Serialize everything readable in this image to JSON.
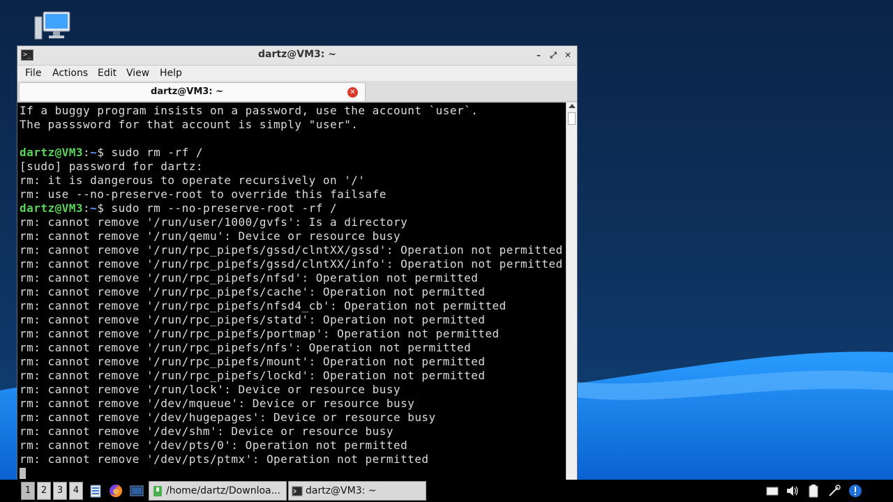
{
  "window": {
    "title": "dartz@VM3: ~",
    "controls": {
      "minimize": "–",
      "maximize": "⤢",
      "close": "✕"
    }
  },
  "menubar": {
    "items": [
      "File",
      "Actions",
      "Edit",
      "View",
      "Help"
    ]
  },
  "tab": {
    "label": "dartz@VM3: ~",
    "close": "✕"
  },
  "terminal": {
    "lines": [
      "If a buggy program insists on a password, use the account `user`.",
      "The passsword for that account is simply \"user\".",
      "",
      {
        "user": "dartz@VM3",
        "sep": ":",
        "path": "~",
        "prompt": "$ ",
        "cmd": "sudo rm -rf /"
      },
      "[sudo] password for dartz:",
      "rm: it is dangerous to operate recursively on '/'",
      "rm: use --no-preserve-root to override this failsafe",
      {
        "user": "dartz@VM3",
        "sep": ":",
        "path": "~",
        "prompt": "$ ",
        "cmd": "sudo rm --no-preserve-root -rf /"
      },
      "rm: cannot remove '/run/user/1000/gvfs': Is a directory",
      "rm: cannot remove '/run/qemu': Device or resource busy",
      "rm: cannot remove '/run/rpc_pipefs/gssd/clntXX/gssd': Operation not permitted",
      "rm: cannot remove '/run/rpc_pipefs/gssd/clntXX/info': Operation not permitted",
      "rm: cannot remove '/run/rpc_pipefs/nfsd': Operation not permitted",
      "rm: cannot remove '/run/rpc_pipefs/cache': Operation not permitted",
      "rm: cannot remove '/run/rpc_pipefs/nfsd4_cb': Operation not permitted",
      "rm: cannot remove '/run/rpc_pipefs/statd': Operation not permitted",
      "rm: cannot remove '/run/rpc_pipefs/portmap': Operation not permitted",
      "rm: cannot remove '/run/rpc_pipefs/nfs': Operation not permitted",
      "rm: cannot remove '/run/rpc_pipefs/mount': Operation not permitted",
      "rm: cannot remove '/run/rpc_pipefs/lockd': Operation not permitted",
      "rm: cannot remove '/run/lock': Device or resource busy",
      "rm: cannot remove '/dev/mqueue': Device or resource busy",
      "rm: cannot remove '/dev/hugepages': Device or resource busy",
      "rm: cannot remove '/dev/shm': Device or resource busy",
      "rm: cannot remove '/dev/pts/0': Operation not permitted",
      "rm: cannot remove '/dev/pts/ptmx': Operation not permitted"
    ]
  },
  "taskbar": {
    "workspaces": [
      "1",
      "2",
      "3",
      "4"
    ],
    "active_workspace": "1",
    "quicklaunch_icons": [
      "file-manager-icon",
      "firefox-icon",
      "terminal-launcher-icon"
    ],
    "tasks": [
      {
        "label": "/home/dartz/Downloa...",
        "icon": "folder-icon"
      },
      {
        "label": "dartz@VM3: ~",
        "icon": "terminal-icon"
      }
    ],
    "tray_icons": [
      "clipboard-icon",
      "volume-icon",
      "battery-icon",
      "network-icon",
      "update-icon"
    ]
  },
  "colors": {
    "desktop": "#0a2447",
    "accent_wave": "#1a8fff",
    "terminal_bg": "#000000",
    "terminal_fg": "#dcdcdc",
    "prompt_user": "#5ad35a",
    "prompt_path": "#6b9bff",
    "tab_close": "#d93a2b"
  }
}
